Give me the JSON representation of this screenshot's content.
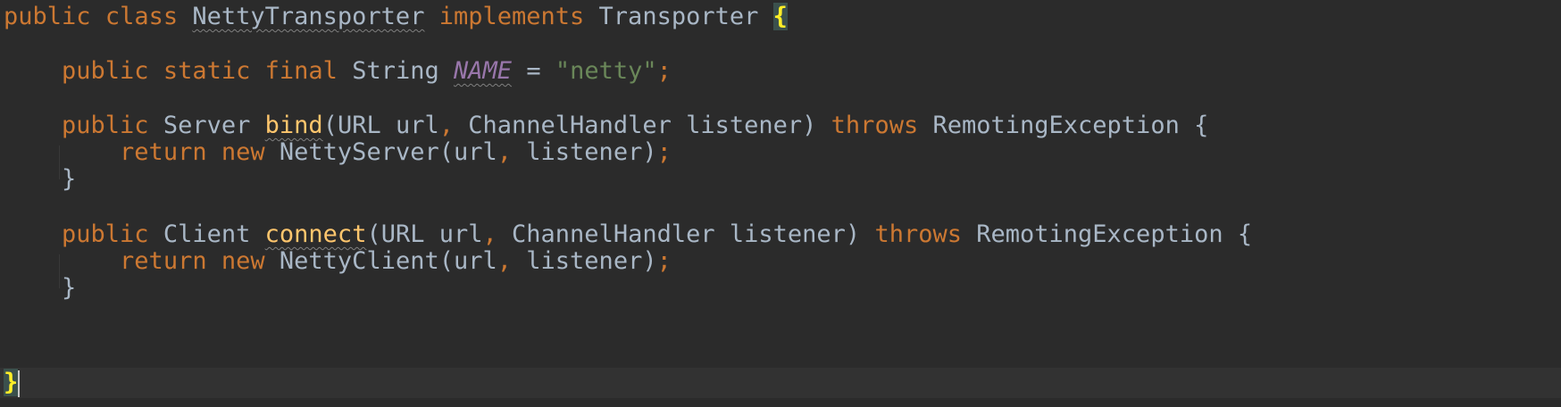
{
  "code": {
    "line1": {
      "kw1": "public",
      "kw2": "class",
      "class_name": "NettyTransporter",
      "kw3": "implements",
      "interface": "Transporter",
      "brace": "{"
    },
    "line2": {
      "kw1": "public",
      "kw2": "static",
      "kw3": "final",
      "type": "String",
      "name": "NAME",
      "eq": "=",
      "value": "\"netty\"",
      "semi": ";"
    },
    "line3": {
      "kw1": "public",
      "type": "Server",
      "method": "bind",
      "params_a": "(URL url",
      "comma": ",",
      "params_b": "ChannelHandler listener)",
      "kw2": "throws",
      "exception": "RemotingException",
      "brace": "{"
    },
    "line4": {
      "kw1": "return",
      "kw2": "new",
      "call_a": "NettyServer(url",
      "comma": ",",
      "call_b": "listener)",
      "semi": ";"
    },
    "line5": {
      "brace": "}"
    },
    "line6": {
      "kw1": "public",
      "type": "Client",
      "method": "connect",
      "params_a": "(URL url",
      "comma": ",",
      "params_b": "ChannelHandler listener)",
      "kw2": "throws",
      "exception": "RemotingException",
      "brace": "{"
    },
    "line7": {
      "kw1": "return",
      "kw2": "new",
      "call_a": "NettyClient(url",
      "comma": ",",
      "call_b": "listener)",
      "semi": ";"
    },
    "line8": {
      "brace": "}"
    },
    "line9": {
      "brace": "}"
    }
  },
  "colors": {
    "background": "#2b2b2b",
    "keyword": "#cc7832",
    "identifier": "#a9b7c6",
    "string": "#6a8759",
    "constant": "#9876aa",
    "method": "#ffc66d",
    "brace_match": "#ffef28"
  }
}
